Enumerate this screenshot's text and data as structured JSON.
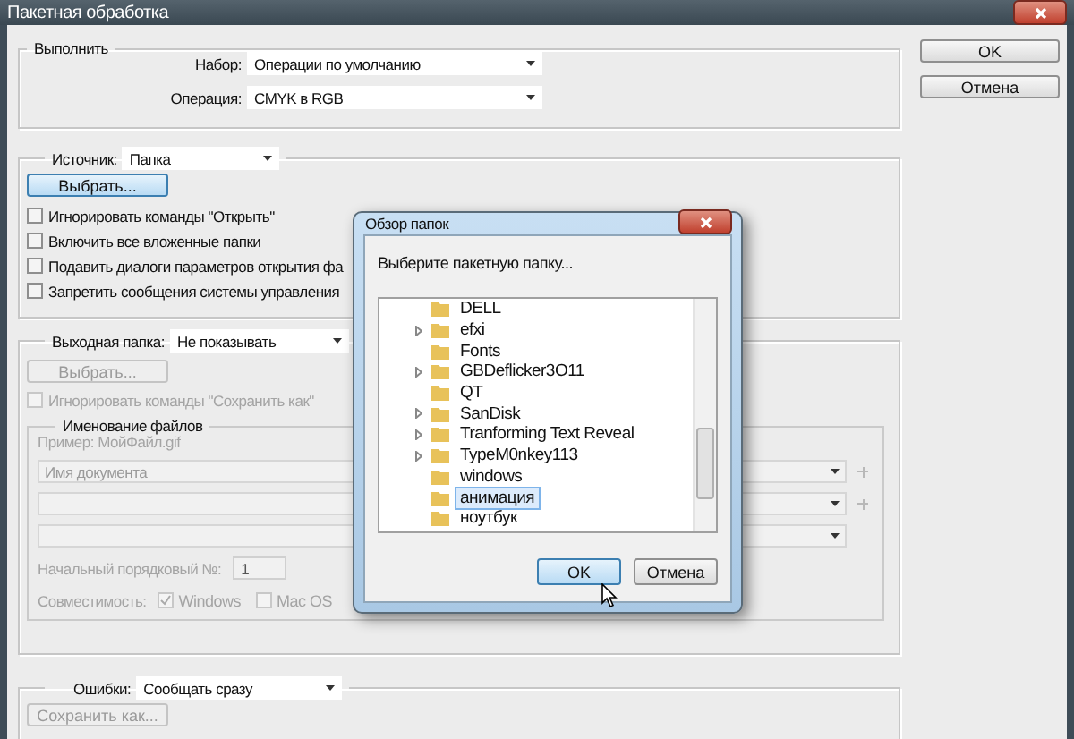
{
  "window": {
    "title": "Пакетная обработка"
  },
  "play": {
    "legend": "Выполнить",
    "rows": [
      {
        "label": "Набор:",
        "value": "Операции по умолчанию"
      },
      {
        "label": "Операция:",
        "value": "CMYK в RGB"
      }
    ]
  },
  "source": {
    "label": "Источник:",
    "value": "Папка",
    "choose": "Выбрать...",
    "options": [
      {
        "label": "Игнорировать команды \"Открыть\"",
        "checked": false
      },
      {
        "label": "Включить все вложенные папки",
        "checked": false
      },
      {
        "label": "Подавить диалоги параметров открытия фа",
        "checked": false
      },
      {
        "label": "Запретить сообщения системы управления",
        "checked": false
      }
    ]
  },
  "destination": {
    "label": "Выходная папка:",
    "value": "Не показывать",
    "disabled": true,
    "choose": "Выбрать...",
    "override": {
      "label": "Игнорировать команды \"Сохранить как\"",
      "checked": false
    },
    "naming": {
      "legend": "Именование файлов",
      "example": "Пример: МойФайл.gif",
      "slots": [
        {
          "value": "Имя документа",
          "add": true
        },
        {
          "add": true
        },
        {
          "add": false
        }
      ],
      "serial": {
        "label": "Начальный порядковый №:",
        "value": "1"
      },
      "compat": {
        "label": "Совместимость:",
        "options": [
          {
            "label": "Windows",
            "checked": true
          },
          {
            "label": "Mac OS",
            "checked": false
          }
        ]
      }
    }
  },
  "errors": {
    "label": "Ошибки:",
    "value": "Сообщать сразу",
    "save_as": "Сохранить как...",
    "disabled": true
  },
  "buttons": [
    {
      "label": "OK"
    },
    {
      "label": "Отмена"
    }
  ],
  "browse_dialog": {
    "title": "Обзор папок",
    "prompt": "Выберите пакетную папку...",
    "folders": [
      {
        "name": "DELL",
        "expandable": false,
        "selected": false
      },
      {
        "name": "efxi",
        "expandable": true,
        "selected": false
      },
      {
        "name": "Fonts",
        "expandable": false,
        "selected": false
      },
      {
        "name": "GBDeflicker3O11",
        "expandable": true,
        "selected": false
      },
      {
        "name": "QT",
        "expandable": false,
        "selected": false
      },
      {
        "name": "SanDisk",
        "expandable": true,
        "selected": false
      },
      {
        "name": "Tranforming Text Reveal",
        "expandable": true,
        "selected": false
      },
      {
        "name": "TypeM0nkey113",
        "expandable": true,
        "selected": false
      },
      {
        "name": "windows",
        "expandable": false,
        "selected": false
      },
      {
        "name": "анимация",
        "expandable": false,
        "selected": true
      },
      {
        "name": "ноутбук",
        "expandable": false,
        "selected": false
      }
    ],
    "buttons": [
      {
        "label": "OK",
        "focused": true
      },
      {
        "label": "Отмена",
        "focused": false
      }
    ]
  }
}
